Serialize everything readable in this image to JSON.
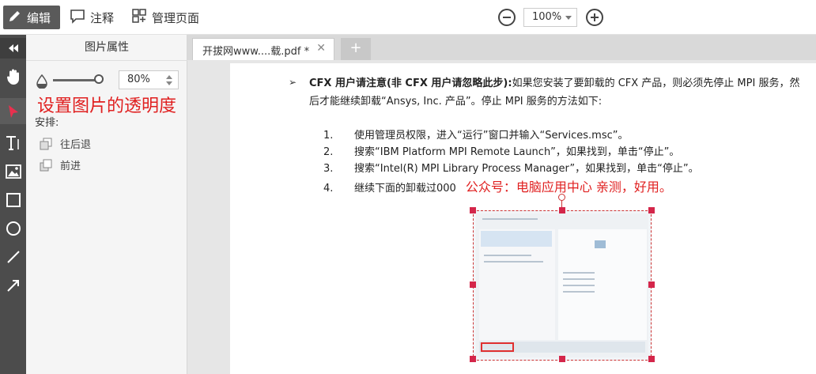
{
  "toolbar": {
    "edit_label": "编辑",
    "annotate_label": "注释",
    "manage_pages_label": "管理页面",
    "zoom_value": "100%"
  },
  "panel": {
    "title": "图片属性",
    "opacity_value": "80%",
    "overlay_note": "设置图片的透明度",
    "arrange_label": "安排:",
    "send_backward_label": "往后退",
    "bring_forward_label": "前进"
  },
  "tabs": {
    "active_tab": "开拔网www....载.pdf *",
    "close_glyph": "✕",
    "add_glyph": "+"
  },
  "document": {
    "bullet_glyph": "➢",
    "heading_bold": "CFX 用户请注意(非 CFX 用户请忽略此步):",
    "heading_rest": "如果您安装了要卸载的 CFX 产品，则必须先停止 MPI 服务，然后才能继续卸载“Ansys, Inc. 产品”。停止 MPI 服务的方法如下:",
    "steps": [
      {
        "num": "1.",
        "text": "使用管理员权限，进入“运行”窗口并输入“Services.msc”。"
      },
      {
        "num": "2.",
        "text": "搜索“IBM Platform MPI Remote Launch”，如果找到，单击“停止”。"
      },
      {
        "num": "3.",
        "text": "搜索“Intel(R) MPI Library Process Manager”，如果找到，单击“停止”。"
      },
      {
        "num": "4.",
        "text": "继续下面的卸载过000"
      }
    ],
    "watermark": "公众号：电脑应用中心 亲测，好用。"
  }
}
